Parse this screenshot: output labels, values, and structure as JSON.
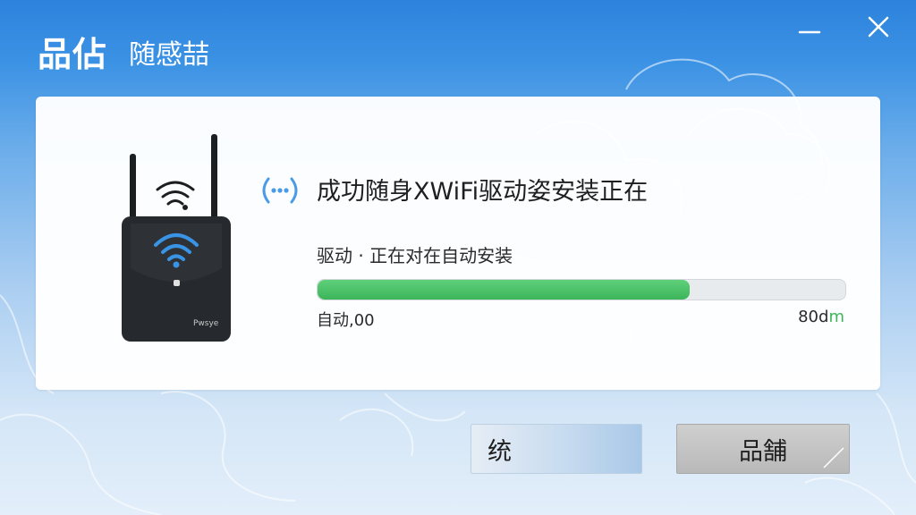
{
  "window": {
    "title": "品佔",
    "subtitle": "随感喆",
    "minimize_icon": "minimize-icon",
    "close_icon": "close-icon"
  },
  "status": {
    "title": "成功随身XWiFi驱动姿安装正在",
    "subtitle": "驱动 · 正在对在自动安装",
    "icon": "loading-dots-icon"
  },
  "device": {
    "icon": "wifi-router-icon",
    "brand": "Pwsye"
  },
  "progress": {
    "fraction": 0.705,
    "left_label": "自动,00",
    "right_label_prefix": "80d",
    "right_label_suffix": "m"
  },
  "buttons": {
    "primary_label": "统",
    "secondary_label": "品舗"
  },
  "colors": {
    "accent": "#2d83dc",
    "progress": "#3cb55a",
    "loading_icon": "#4a9be6"
  }
}
